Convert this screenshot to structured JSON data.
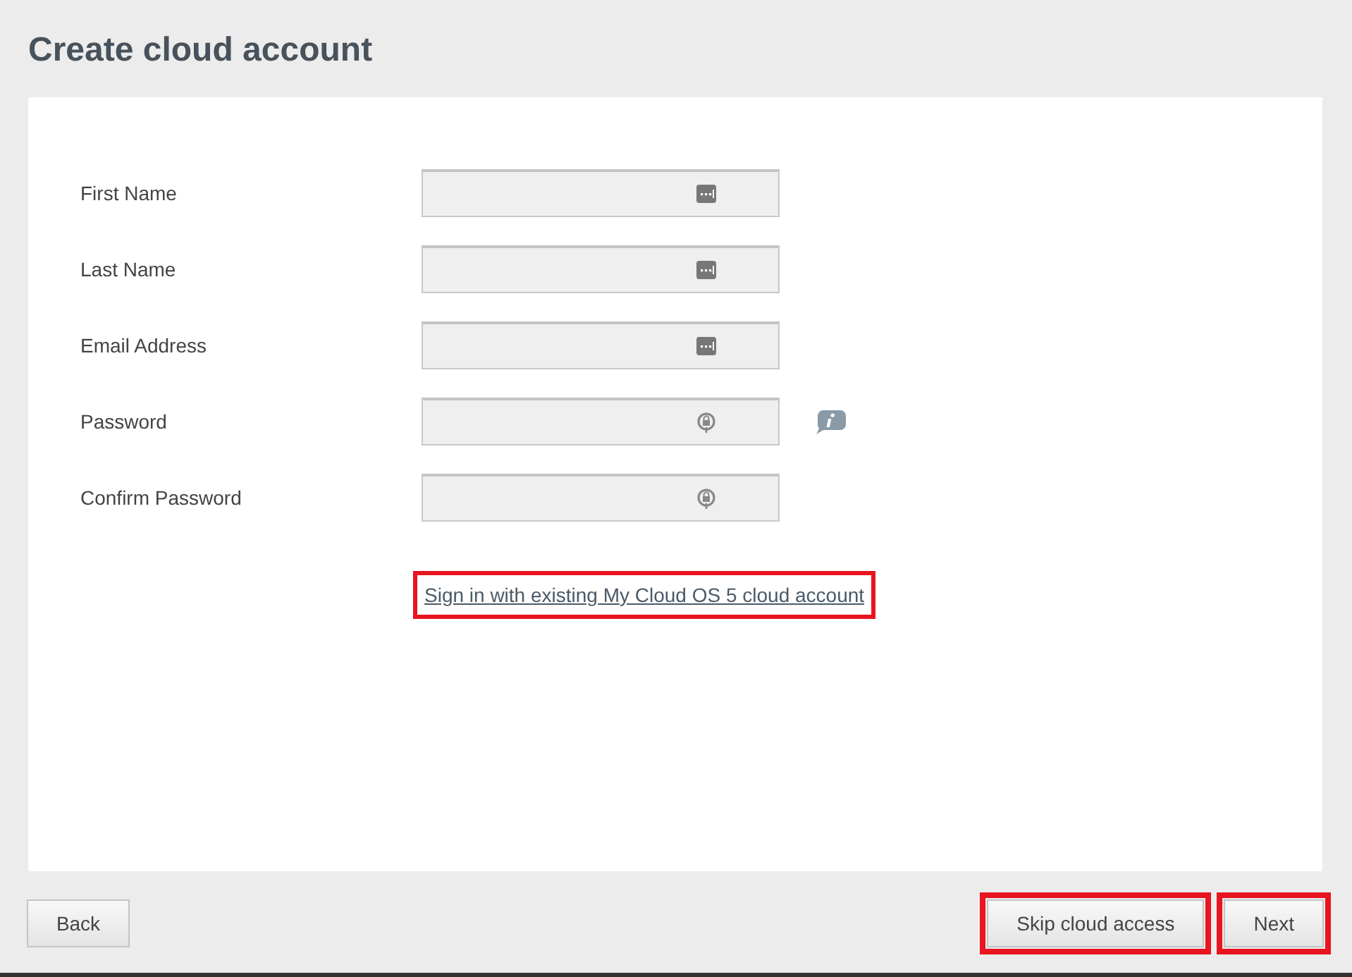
{
  "title": "Create cloud account",
  "fields": [
    {
      "label": "First Name",
      "kind": "text"
    },
    {
      "label": "Last Name",
      "kind": "text"
    },
    {
      "label": "Email Address",
      "kind": "text"
    },
    {
      "label": "Password",
      "kind": "password",
      "info": true
    },
    {
      "label": "Confirm Password",
      "kind": "password"
    }
  ],
  "link": {
    "label": "Sign in with existing My Cloud OS 5 cloud account",
    "highlighted": true
  },
  "buttons": [
    {
      "label": "Back",
      "highlighted": false
    },
    {
      "label": "Skip cloud access",
      "highlighted": true
    },
    {
      "label": "Next",
      "highlighted": true
    }
  ]
}
